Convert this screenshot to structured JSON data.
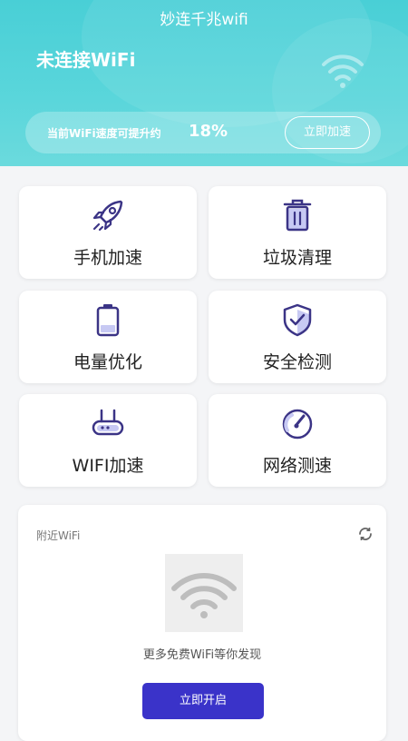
{
  "header": {
    "app_title": "妙连千兆wifi",
    "connection_status": "未连接WiFi",
    "speed_text": "当前WiFi速度可提升约",
    "speed_percent": "18%",
    "boost_button": "立即加速"
  },
  "features": [
    {
      "label": "手机加速",
      "icon": "rocket-icon"
    },
    {
      "label": "垃圾清理",
      "icon": "trash-icon"
    },
    {
      "label": "电量优化",
      "icon": "battery-icon"
    },
    {
      "label": "安全检测",
      "icon": "shield-check-icon"
    },
    {
      "label": "WIFI加速",
      "icon": "router-icon"
    },
    {
      "label": "网络测速",
      "icon": "speedometer-icon"
    }
  ],
  "nearby": {
    "title": "附近WiFi",
    "hint": "更多免费WiFi等你发现",
    "enable_button": "立即开启"
  },
  "colors": {
    "header_teal": "#4fd2d8",
    "icon_purple": "#3b3486",
    "primary_button": "#3a33c9"
  }
}
